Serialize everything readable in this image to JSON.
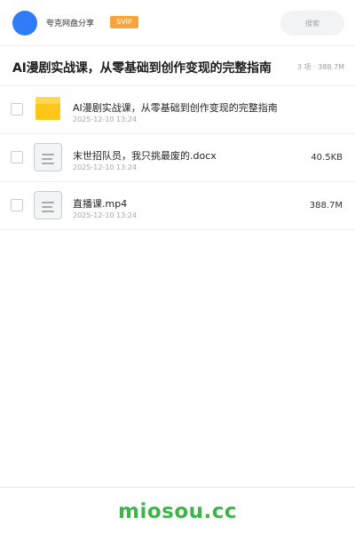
{
  "header": {
    "share_name": "夸克网盘分享",
    "badge": "SVIP",
    "search_placeholder": "搜索"
  },
  "title_bar": {
    "title": "AI漫剧实战课，从零基础到创作变现的完整指南",
    "summary": "3 项 · 388.7M"
  },
  "files": [
    {
      "name": "AI漫剧实战课，从零基础到创作变现的完整指南",
      "date": "2025-12-10 13:24",
      "size": "",
      "icon": "folder-icon"
    },
    {
      "name": "末世招队员，我只挑最废的.docx",
      "date": "2025-12-10 13:24",
      "size": "40.5KB",
      "icon": "document-icon"
    },
    {
      "name": "直播课.mp4",
      "date": "2025-12-10 13:24",
      "size": "388.7M",
      "icon": "document-icon"
    }
  ],
  "footer": {
    "brand": "miosou.cc"
  },
  "colors": {
    "accent": "#2f7cf6",
    "svip": "#f7a53a",
    "folder": "#ffc61a",
    "brand": "#3db34a"
  }
}
